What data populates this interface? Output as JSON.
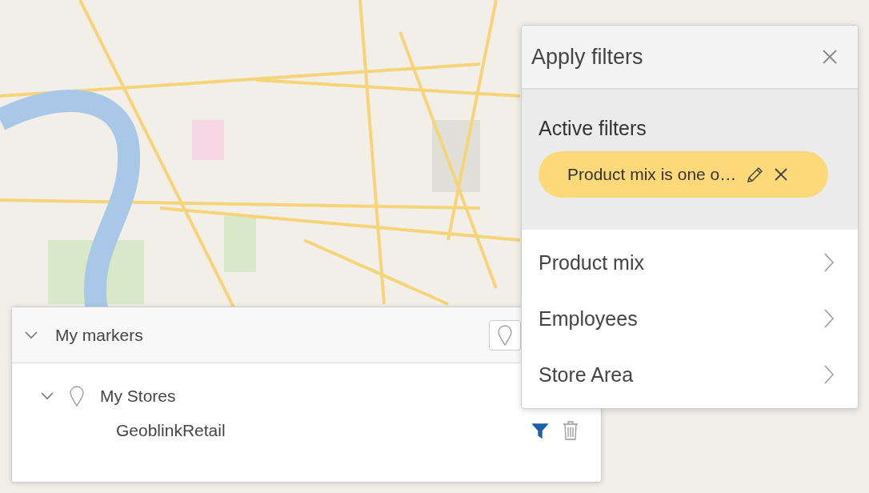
{
  "markers_panel": {
    "title": "My markers",
    "expanded": true,
    "groups": [
      {
        "name": "My Stores",
        "expanded": true,
        "children": [
          {
            "name": "GeoblinkRetail",
            "filtered": true
          }
        ]
      }
    ]
  },
  "filters_panel": {
    "title": "Apply filters",
    "active_heading": "Active filters",
    "active_filters": [
      {
        "label": "Product mix is one o…"
      }
    ],
    "categories": [
      {
        "label": "Product mix"
      },
      {
        "label": "Employees"
      },
      {
        "label": "Store Area"
      }
    ]
  }
}
